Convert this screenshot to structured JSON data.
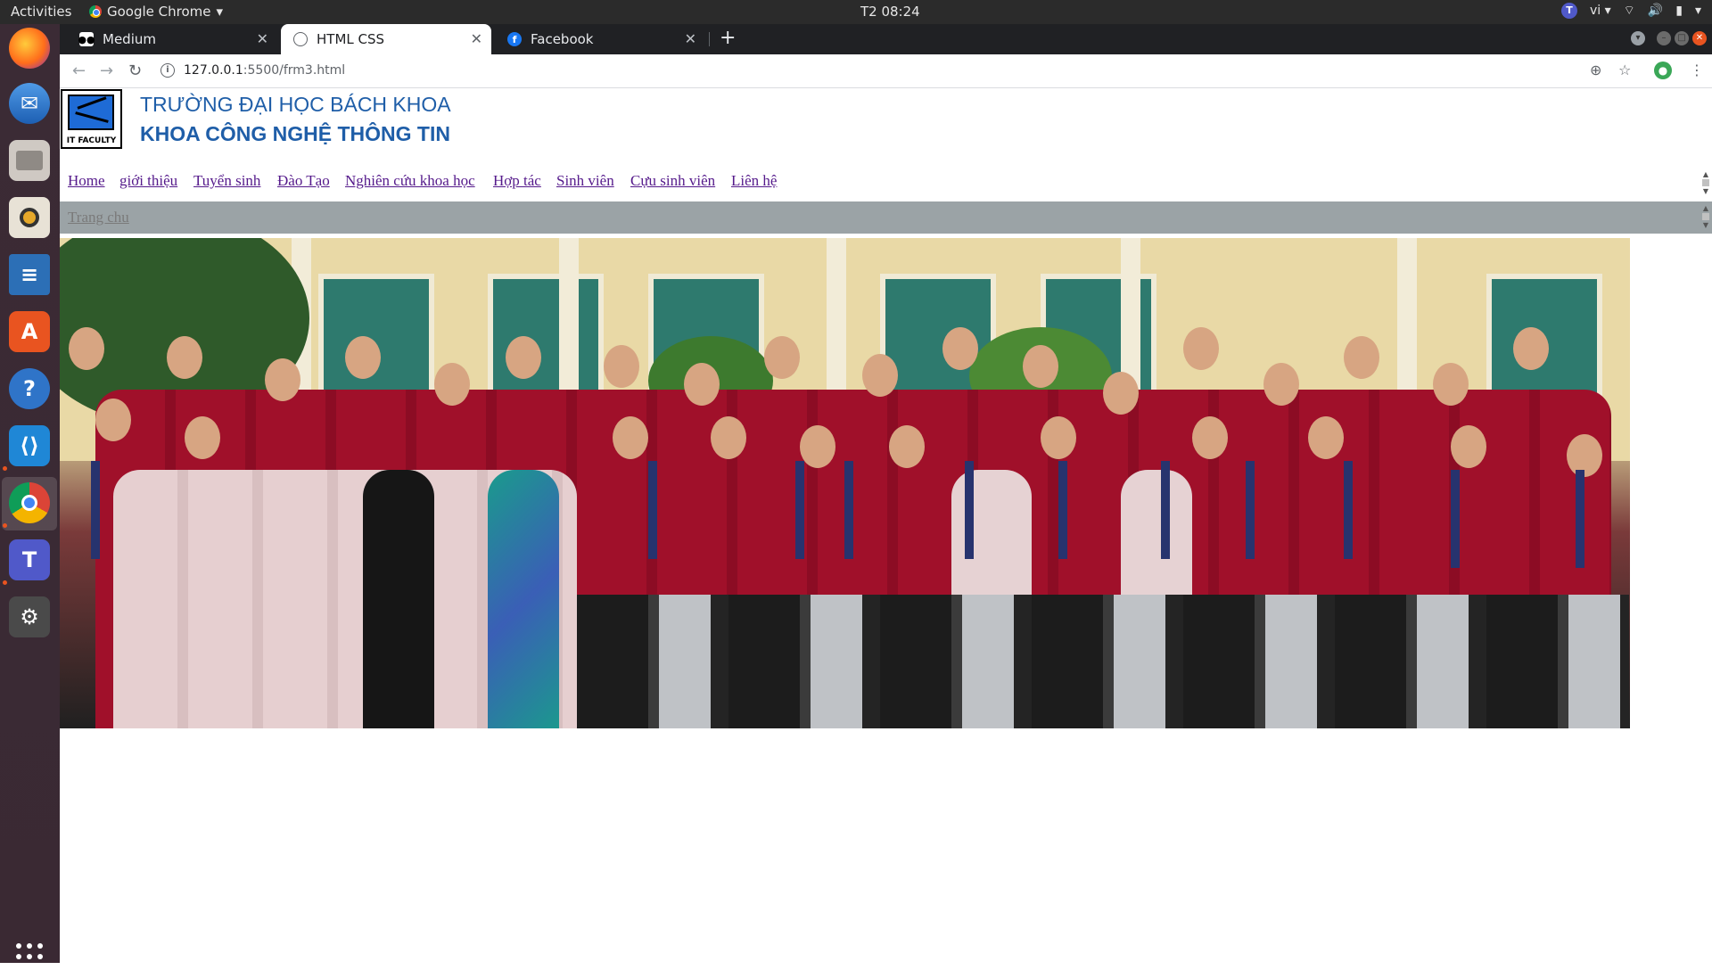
{
  "system_bar": {
    "activities": "Activities",
    "app_name": "Google Chrome",
    "clock": "T2 08:24",
    "language": "vi"
  },
  "browser": {
    "tabs": [
      {
        "title": "Medium",
        "icon": "medium-icon",
        "active": false
      },
      {
        "title": "HTML CSS",
        "icon": "globe-icon",
        "active": true
      },
      {
        "title": "Facebook",
        "icon": "facebook-icon",
        "active": false
      }
    ],
    "url_host": "127.0.0.1",
    "url_rest": ":5500/frm3.html"
  },
  "site": {
    "school_name": "TRƯỜNG ĐẠI HỌC BÁCH KHOA",
    "faculty_name": "KHOA CÔNG NGHỆ THÔNG TIN",
    "logo_text": "IT FACULTY",
    "nav": [
      "Home ",
      "giới thiệu",
      "Tuyển sinh",
      "Đào Tạo",
      "Nghiên cứu khoa học",
      "Hợp tác",
      "Sinh viên",
      "Cựu sinh viên",
      "Liên hệ"
    ],
    "breadcrumb": "Trang chu",
    "colors": {
      "title_blue": "#1f5ea8",
      "link_visited": "#551a8b",
      "subbar_gray": "#9ba3a6"
    }
  }
}
